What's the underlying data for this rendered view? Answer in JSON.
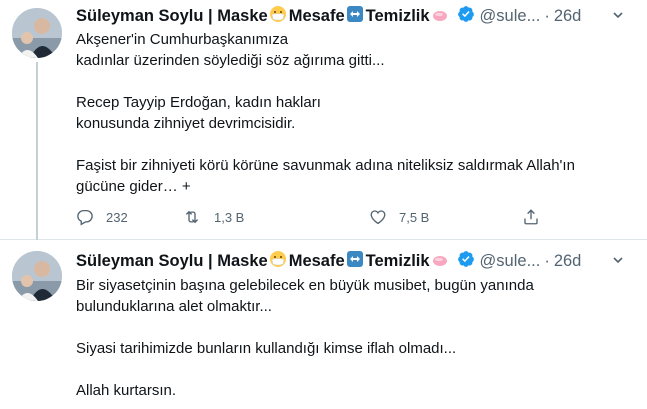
{
  "colors": {
    "verified": "#1d9bf0",
    "muted": "#536471",
    "text": "#0f1419",
    "divider": "#dfe6ea"
  },
  "tweets": [
    {
      "author": {
        "name": "Süleyman Soylu | Maske",
        "name_emoji_1": "face-with-medical-mask-emoji",
        "name_part_2": "Mesafe",
        "name_emoji_2": "left-right-arrow-emoji",
        "name_part_3": "Temizlik",
        "name_emoji_3": "soap-emoji",
        "handle": "@sule...",
        "separator": "·",
        "time": "26d"
      },
      "text_lines": [
        "Akşener'in Cumhurbaşkanımıza",
        "kadınlar üzerinden söylediği söz ağırıma gitti...",
        "",
        "Recep Tayyip Erdoğan, kadın hakları",
        "konusunda zihniyet devrimcisidir.",
        "",
        "Faşist bir zihniyeti körü körüne savunmak adına niteliksiz saldırmak Allah'ın",
        "gücüne gider… +"
      ],
      "actions": {
        "reply_count": "232",
        "retweet_count": "1,3 B",
        "like_count": "7,5 B"
      }
    },
    {
      "author": {
        "name": "Süleyman Soylu | Maske",
        "name_emoji_1": "face-with-medical-mask-emoji",
        "name_part_2": "Mesafe",
        "name_emoji_2": "left-right-arrow-emoji",
        "name_part_3": "Temizlik",
        "name_emoji_3": "soap-emoji",
        "handle": "@sule...",
        "separator": "·",
        "time": "26d"
      },
      "text_lines": [
        "Bir siyasetçinin başına gelebilecek en büyük musibet, bugün yanında",
        "bulunduklarına alet olmaktır...",
        "",
        "Siyasi tarihimizde bunların kullandığı kimse iflah olmadı...",
        "",
        "Allah kurtarsın."
      ]
    }
  ]
}
